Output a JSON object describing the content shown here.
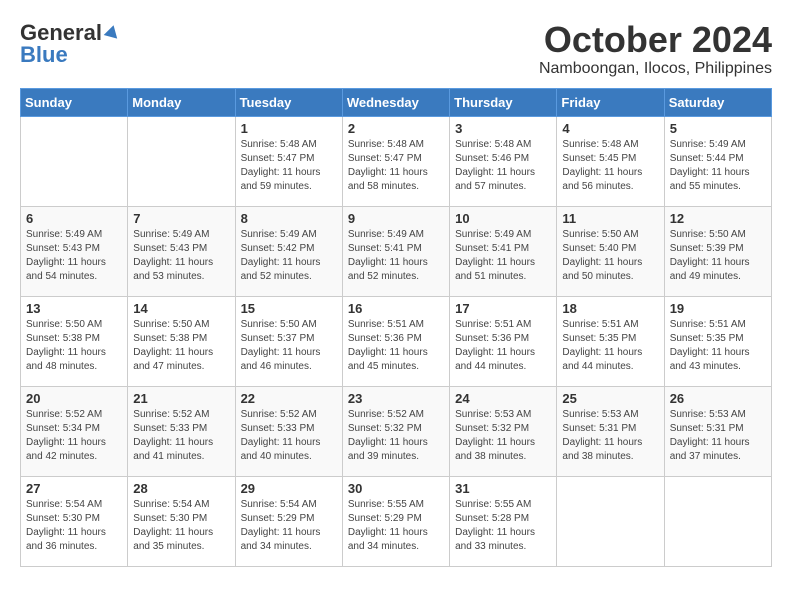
{
  "header": {
    "logo_general": "General",
    "logo_blue": "Blue",
    "month": "October 2024",
    "location": "Namboongan, Ilocos, Philippines"
  },
  "days_of_week": [
    "Sunday",
    "Monday",
    "Tuesday",
    "Wednesday",
    "Thursday",
    "Friday",
    "Saturday"
  ],
  "weeks": [
    [
      {
        "day": null,
        "text": ""
      },
      {
        "day": null,
        "text": ""
      },
      {
        "day": "1",
        "sunrise": "5:48 AM",
        "sunset": "5:47 PM",
        "daylight": "11 hours and 59 minutes."
      },
      {
        "day": "2",
        "sunrise": "5:48 AM",
        "sunset": "5:47 PM",
        "daylight": "11 hours and 58 minutes."
      },
      {
        "day": "3",
        "sunrise": "5:48 AM",
        "sunset": "5:46 PM",
        "daylight": "11 hours and 57 minutes."
      },
      {
        "day": "4",
        "sunrise": "5:48 AM",
        "sunset": "5:45 PM",
        "daylight": "11 hours and 56 minutes."
      },
      {
        "day": "5",
        "sunrise": "5:49 AM",
        "sunset": "5:44 PM",
        "daylight": "11 hours and 55 minutes."
      }
    ],
    [
      {
        "day": "6",
        "sunrise": "5:49 AM",
        "sunset": "5:43 PM",
        "daylight": "11 hours and 54 minutes."
      },
      {
        "day": "7",
        "sunrise": "5:49 AM",
        "sunset": "5:43 PM",
        "daylight": "11 hours and 53 minutes."
      },
      {
        "day": "8",
        "sunrise": "5:49 AM",
        "sunset": "5:42 PM",
        "daylight": "11 hours and 52 minutes."
      },
      {
        "day": "9",
        "sunrise": "5:49 AM",
        "sunset": "5:41 PM",
        "daylight": "11 hours and 52 minutes."
      },
      {
        "day": "10",
        "sunrise": "5:49 AM",
        "sunset": "5:41 PM",
        "daylight": "11 hours and 51 minutes."
      },
      {
        "day": "11",
        "sunrise": "5:50 AM",
        "sunset": "5:40 PM",
        "daylight": "11 hours and 50 minutes."
      },
      {
        "day": "12",
        "sunrise": "5:50 AM",
        "sunset": "5:39 PM",
        "daylight": "11 hours and 49 minutes."
      }
    ],
    [
      {
        "day": "13",
        "sunrise": "5:50 AM",
        "sunset": "5:38 PM",
        "daylight": "11 hours and 48 minutes."
      },
      {
        "day": "14",
        "sunrise": "5:50 AM",
        "sunset": "5:38 PM",
        "daylight": "11 hours and 47 minutes."
      },
      {
        "day": "15",
        "sunrise": "5:50 AM",
        "sunset": "5:37 PM",
        "daylight": "11 hours and 46 minutes."
      },
      {
        "day": "16",
        "sunrise": "5:51 AM",
        "sunset": "5:36 PM",
        "daylight": "11 hours and 45 minutes."
      },
      {
        "day": "17",
        "sunrise": "5:51 AM",
        "sunset": "5:36 PM",
        "daylight": "11 hours and 44 minutes."
      },
      {
        "day": "18",
        "sunrise": "5:51 AM",
        "sunset": "5:35 PM",
        "daylight": "11 hours and 44 minutes."
      },
      {
        "day": "19",
        "sunrise": "5:51 AM",
        "sunset": "5:35 PM",
        "daylight": "11 hours and 43 minutes."
      }
    ],
    [
      {
        "day": "20",
        "sunrise": "5:52 AM",
        "sunset": "5:34 PM",
        "daylight": "11 hours and 42 minutes."
      },
      {
        "day": "21",
        "sunrise": "5:52 AM",
        "sunset": "5:33 PM",
        "daylight": "11 hours and 41 minutes."
      },
      {
        "day": "22",
        "sunrise": "5:52 AM",
        "sunset": "5:33 PM",
        "daylight": "11 hours and 40 minutes."
      },
      {
        "day": "23",
        "sunrise": "5:52 AM",
        "sunset": "5:32 PM",
        "daylight": "11 hours and 39 minutes."
      },
      {
        "day": "24",
        "sunrise": "5:53 AM",
        "sunset": "5:32 PM",
        "daylight": "11 hours and 38 minutes."
      },
      {
        "day": "25",
        "sunrise": "5:53 AM",
        "sunset": "5:31 PM",
        "daylight": "11 hours and 38 minutes."
      },
      {
        "day": "26",
        "sunrise": "5:53 AM",
        "sunset": "5:31 PM",
        "daylight": "11 hours and 37 minutes."
      }
    ],
    [
      {
        "day": "27",
        "sunrise": "5:54 AM",
        "sunset": "5:30 PM",
        "daylight": "11 hours and 36 minutes."
      },
      {
        "day": "28",
        "sunrise": "5:54 AM",
        "sunset": "5:30 PM",
        "daylight": "11 hours and 35 minutes."
      },
      {
        "day": "29",
        "sunrise": "5:54 AM",
        "sunset": "5:29 PM",
        "daylight": "11 hours and 34 minutes."
      },
      {
        "day": "30",
        "sunrise": "5:55 AM",
        "sunset": "5:29 PM",
        "daylight": "11 hours and 34 minutes."
      },
      {
        "day": "31",
        "sunrise": "5:55 AM",
        "sunset": "5:28 PM",
        "daylight": "11 hours and 33 minutes."
      },
      {
        "day": null,
        "text": ""
      },
      {
        "day": null,
        "text": ""
      }
    ]
  ]
}
